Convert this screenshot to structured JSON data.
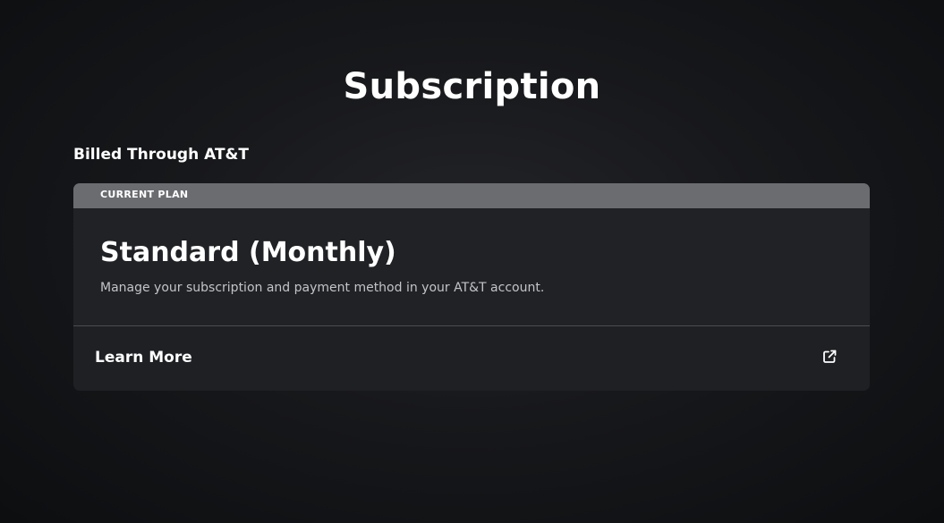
{
  "page": {
    "title": "Subscription"
  },
  "billing": {
    "heading": "Billed Through AT&T"
  },
  "plan_card": {
    "tag": "CURRENT PLAN",
    "plan_name": "Standard (Monthly)",
    "description": "Manage your subscription and payment method in your AT&T account.",
    "link_label": "Learn More",
    "link_icon": "external-link-icon"
  },
  "colors": {
    "background": "#17181b",
    "card": "#1e2024",
    "tag_bar": "#6b6c70",
    "text": "#ffffff",
    "muted_text": "#c3c4c8"
  }
}
